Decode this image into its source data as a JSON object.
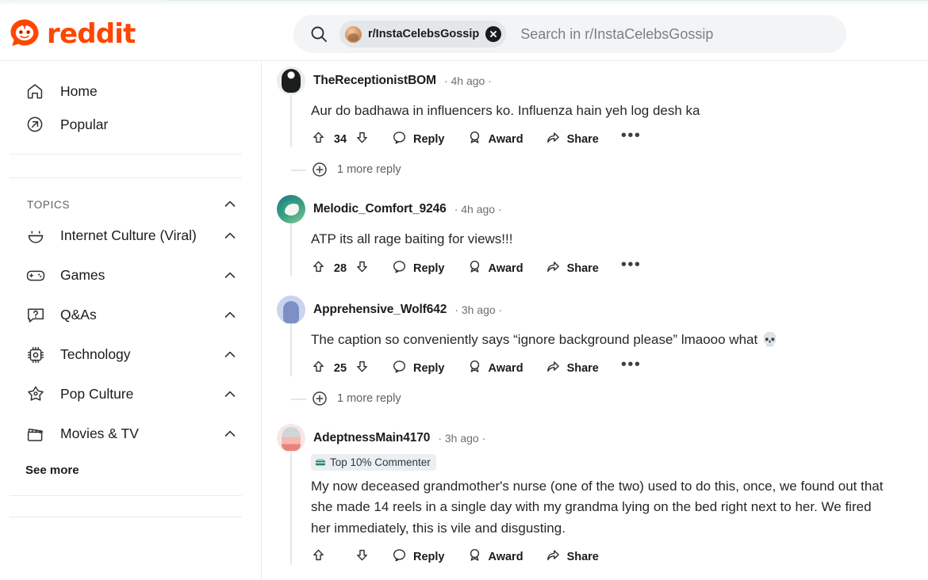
{
  "header": {
    "brand_name": "reddit",
    "brand_color": "#ff4500",
    "search": {
      "icon": "search-icon",
      "chip_label": "r/InstaCelebsGossip",
      "chip_close_icon": "close-icon",
      "placeholder": "Search in r/InstaCelebsGossip"
    }
  },
  "sidebar": {
    "nav": [
      {
        "label": "Home",
        "icon": "home-icon"
      },
      {
        "label": "Popular",
        "icon": "popular-arrow-icon"
      }
    ],
    "topics_section": {
      "title": "TOPICS",
      "collapse_icon": "chevron-up-icon"
    },
    "topics": [
      {
        "label": "Internet Culture (Viral)",
        "icon": "smiley-icon",
        "chevron": "chevron-up-icon"
      },
      {
        "label": "Games",
        "icon": "gamepad-icon",
        "chevron": "chevron-up-icon"
      },
      {
        "label": "Q&As",
        "icon": "question-bubble-icon",
        "chevron": "chevron-up-icon"
      },
      {
        "label": "Technology",
        "icon": "chip-icon",
        "chevron": "chevron-up-icon"
      },
      {
        "label": "Pop Culture",
        "icon": "star-icon",
        "chevron": "chevron-up-icon"
      },
      {
        "label": "Movies & TV",
        "icon": "clapperboard-icon",
        "chevron": "chevron-up-icon"
      }
    ],
    "see_more_label": "See more"
  },
  "action_labels": {
    "reply": "Reply",
    "award": "Award",
    "share": "Share",
    "more": "•••",
    "upvote_icon": "upvote-arrow-icon",
    "downvote_icon": "downvote-arrow-icon",
    "reply_icon": "comment-bubble-icon",
    "award_icon": "award-icon",
    "share_icon": "share-arrow-icon"
  },
  "comments": [
    {
      "username": "TheReceptionistBOM",
      "meta": "· 4h ago ·",
      "avatar": "avatar-dark-snoo",
      "body": "Aur do badhawa in influencers ko. Influenza hain yeh log desh ka",
      "score": "34",
      "more_replies": "1 more reply",
      "badge": null
    },
    {
      "username": "Melodic_Comfort_9246",
      "meta": "· 4h ago ·",
      "avatar": "avatar-green-snoo",
      "body": "ATP its all rage baiting for views!!!",
      "score": "28",
      "more_replies": null,
      "badge": null
    },
    {
      "username": "Apprehensive_Wolf642",
      "meta": "· 3h ago ·",
      "avatar": "avatar-blue-snoo",
      "body": "The caption so conveniently says “ignore background please” lmaooo what 💀",
      "score": "25",
      "more_replies": "1 more reply",
      "badge": null
    },
    {
      "username": "AdeptnessMain4170",
      "meta": "· 3h ago ·",
      "avatar": "avatar-pink-snoo",
      "body": "My now deceased grandmother's nurse (one of the two) used to do this, once, we found out that she made 14 reels in a single day with my grandma lying on the bed right next to her. We fired her immediately, this is vile and disgusting.",
      "score": "",
      "more_replies": null,
      "badge": {
        "label": "Top 10% Commenter",
        "icon": "top-commenter-icon"
      }
    }
  ]
}
